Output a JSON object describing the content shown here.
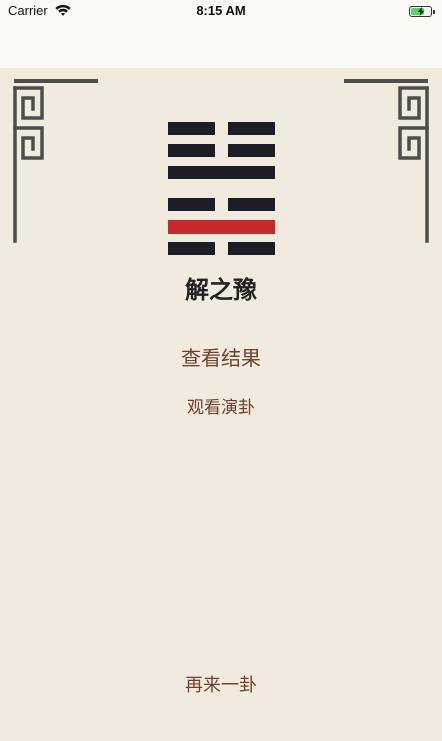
{
  "status_bar": {
    "carrier": "Carrier",
    "time": "8:15 AM",
    "battery": {
      "level": 0.7,
      "charging": true
    }
  },
  "icons": {
    "wifi": "wifi-icon",
    "battery": "battery-icon",
    "charging": "lightning-bolt-icon",
    "corner_ornament": "fret-pattern-icon"
  },
  "hexagram": {
    "lines": [
      {
        "solid": false
      },
      {
        "solid": false
      },
      {
        "solid": true
      },
      {
        "solid": false
      },
      {
        "solid": true,
        "changing": true
      },
      {
        "solid": false
      }
    ]
  },
  "result": {
    "title": "解之豫"
  },
  "actions": {
    "view_result": "查看结果",
    "watch_divination": "观看演卦",
    "divine_again": "再来一卦"
  },
  "colors": {
    "status_background": "#fbf9f4",
    "content_background": "#f1ebdf",
    "line": "#1d1d27",
    "changing_line": "#c72a2b",
    "title_text": "#222222",
    "action_text": "#72402f",
    "ornament": "#4d4d4d",
    "battery_fill": "#4cd964"
  }
}
